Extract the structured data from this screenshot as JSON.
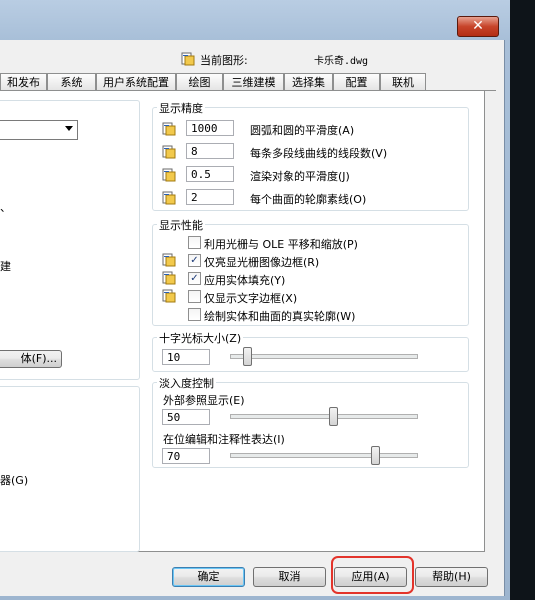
{
  "window": {
    "close_symbol": "✕"
  },
  "header": {
    "current_drawing_label": "当前图形:",
    "current_drawing_file": "卡乐奇.dwg"
  },
  "tabs": [
    {
      "label": "和发布"
    },
    {
      "label": "系统"
    },
    {
      "label": "用户系统配置"
    },
    {
      "label": "绘图"
    },
    {
      "label": "三维建模"
    },
    {
      "label": "选择集"
    },
    {
      "label": "配置"
    },
    {
      "label": "联机"
    }
  ],
  "active_tab_index": 2,
  "left_panel": {
    "partial_text_1": "、",
    "partial_text_2": "建",
    "font_button_label": "体(F)...",
    "partial_text_3": "器(G)"
  },
  "display_resolution": {
    "title": "显示精度",
    "rows": [
      {
        "value": "1000",
        "label": "圆弧和圆的平滑度(A)"
      },
      {
        "value": "8",
        "label": "每条多段线曲线的线段数(V)"
      },
      {
        "value": "0.5",
        "label": "渲染对象的平滑度(J)"
      },
      {
        "value": "2",
        "label": "每个曲面的轮廓素线(O)"
      }
    ]
  },
  "display_performance": {
    "title": "显示性能",
    "options": [
      {
        "label": "利用光栅与 OLE 平移和缩放(P)",
        "checked": false,
        "has_icon": false
      },
      {
        "label": "仅亮显光栅图像边框(R)",
        "checked": true,
        "has_icon": true
      },
      {
        "label": "应用实体填充(Y)",
        "checked": true,
        "has_icon": true
      },
      {
        "label": "仅显示文字边框(X)",
        "checked": false,
        "has_icon": true
      },
      {
        "label": "绘制实体和曲面的真实轮廓(W)",
        "checked": false,
        "has_icon": false
      }
    ]
  },
  "crosshair": {
    "title": "十字光标大小(Z)",
    "value": "10",
    "level": 10
  },
  "fade_control": {
    "title": "淡入度控制",
    "xref_label": "外部参照显示(E)",
    "xref_value": "50",
    "xref_level": 50,
    "inplace_label": "在位编辑和注释性表达(I)",
    "inplace_value": "70",
    "inplace_level": 70
  },
  "buttons": {
    "ok": "确定",
    "cancel": "取消",
    "apply": "应用(A)",
    "help": "帮助(H)"
  },
  "colors": {
    "highlight": "#e3342b",
    "check": "#1d3b78"
  }
}
